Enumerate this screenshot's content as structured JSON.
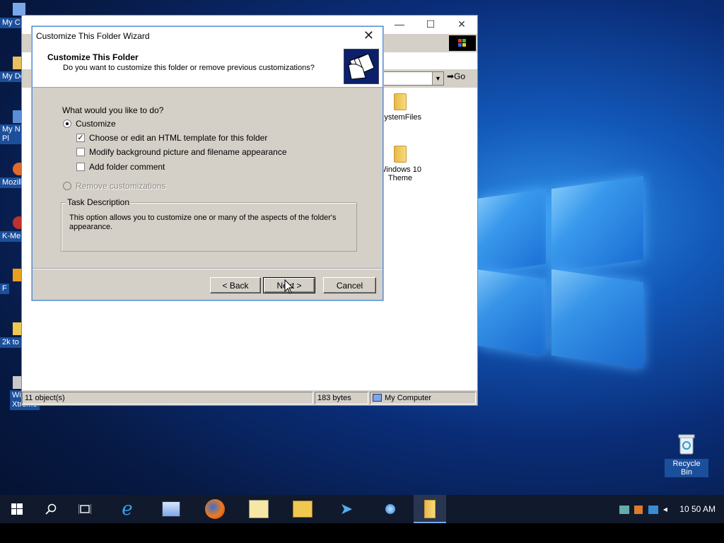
{
  "colors": {
    "accent": "#1c4f9b",
    "dialog_bg": "#d4d0c8",
    "taskbar": "#101a2c"
  },
  "desktop": {
    "left_icons": [
      {
        "label": "My C",
        "icon": "computer-icon"
      },
      {
        "label": "My Do",
        "icon": "documents-icon"
      },
      {
        "label": "My N Pl",
        "icon": "network-icon"
      },
      {
        "label": "Mozill",
        "icon": "app-shortcut-icon"
      },
      {
        "label": "K-Me",
        "icon": "app-shortcut-icon"
      },
      {
        "label": "F",
        "icon": "app-shortcut-icon"
      },
      {
        "label": "2k to",
        "icon": "folder-icon"
      },
      {
        "label": "Wi Xtreme",
        "icon": "app-shortcut-icon"
      }
    ],
    "recycle_bin_label": "Recycle Bin"
  },
  "explorer": {
    "go_label": "Go",
    "files": [
      {
        "label": "SystemFiles"
      },
      {
        "label": "Windows 10 Theme"
      }
    ],
    "status": {
      "objects": "11 object(s)",
      "size": "183 bytes",
      "location": "My Computer"
    }
  },
  "wizard": {
    "title": "Customize This Folder Wizard",
    "header_title": "Customize This Folder",
    "header_subtitle": "Do you want to customize this folder or remove previous customizations?",
    "question": "What would you like to do?",
    "option_customize": "Customize",
    "check_html_template": "Choose or edit an HTML template for this folder",
    "check_background": "Modify background picture and filename appearance",
    "check_comment": "Add folder comment",
    "option_remove": "Remove customizations",
    "task_legend": "Task Description",
    "task_description": "This option allows you to customize one or many of the aspects of the folder's appearance.",
    "back_label": "< Back",
    "next_label": "Next >",
    "cancel_label": "Cancel"
  },
  "taskbar": {
    "clock": "10 50 AM"
  }
}
